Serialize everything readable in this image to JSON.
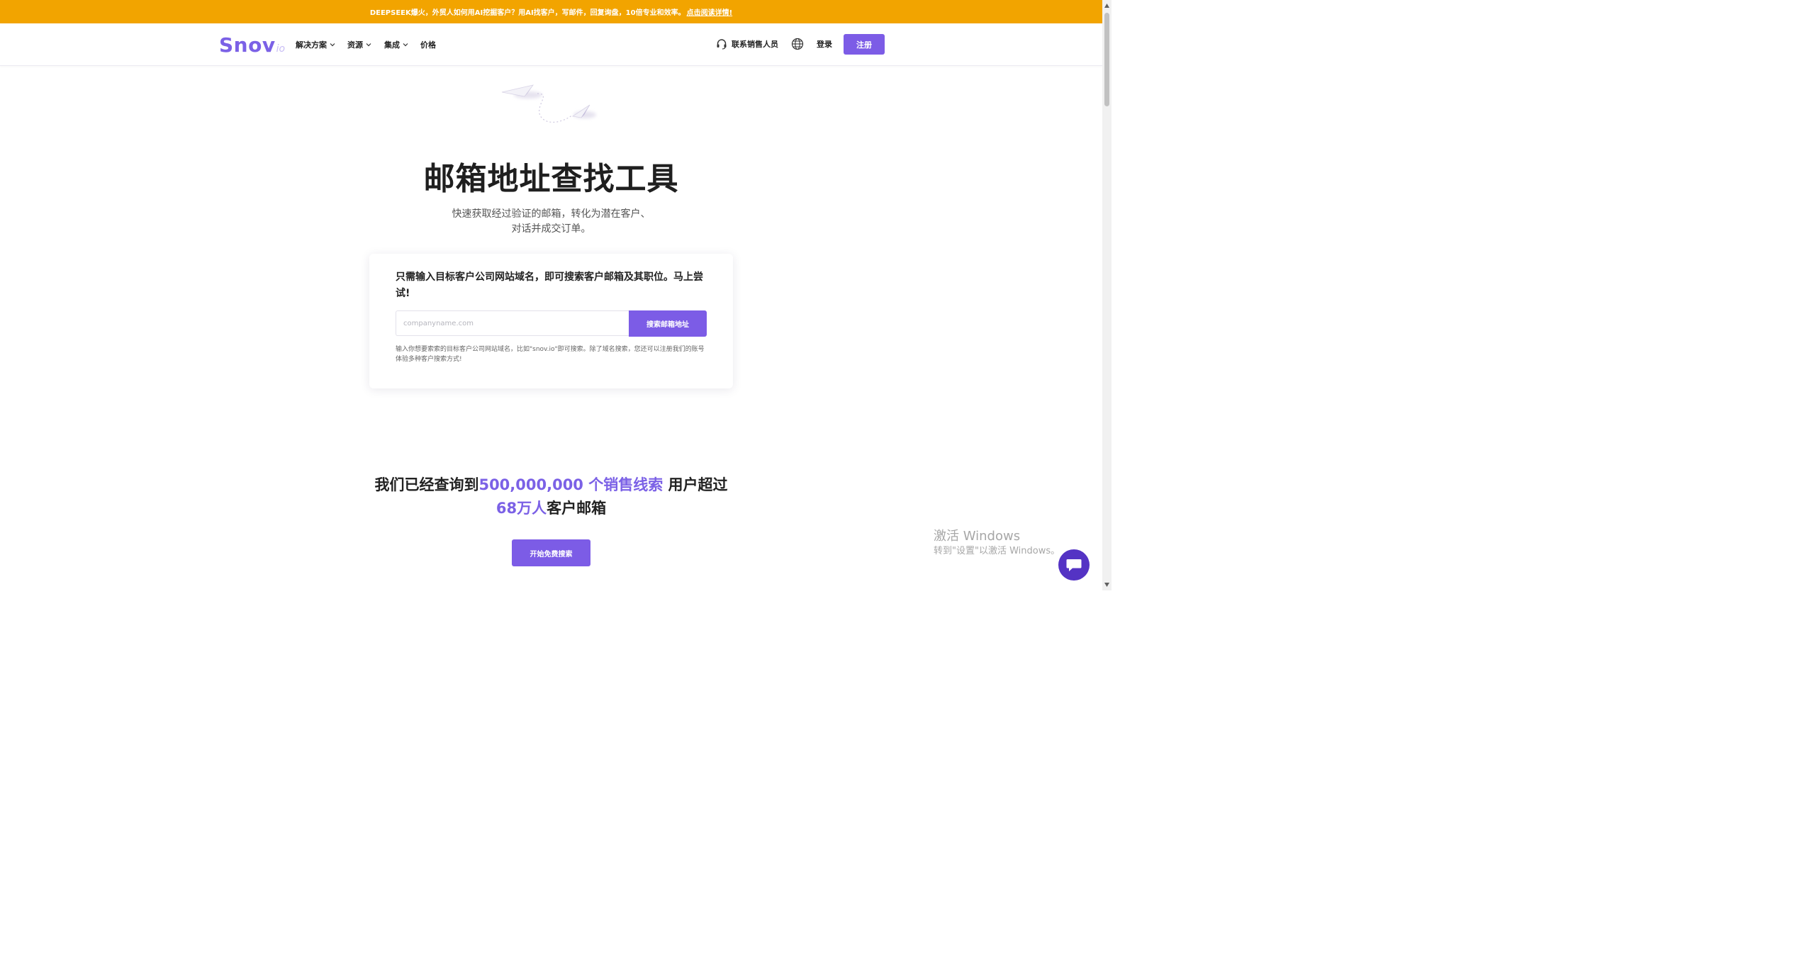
{
  "banner": {
    "text": "DEEPSEEK爆火，外贸人如何用AI挖掘客户？用AI找客户，写邮件，回复询盘，10倍专业和效率。",
    "link": "点击阅读详情!"
  },
  "nav": {
    "logo_main": "Snov",
    "logo_suffix": "io",
    "items": [
      {
        "label": "解决方案"
      },
      {
        "label": "资源"
      },
      {
        "label": "集成"
      },
      {
        "label": "价格"
      }
    ],
    "contact": "联系销售人员",
    "login": "登录",
    "signup": "注册"
  },
  "hero": {
    "title": "邮箱地址查找工具",
    "subtitle_line1": "快速获取经过验证的邮箱，转化为潜在客户、",
    "subtitle_line2": "对话并成交订单。"
  },
  "search_card": {
    "heading": "只需输入目标客户公司网站域名，即可搜索客户邮箱及其职位。马上尝试!",
    "placeholder": "companyname.com",
    "button": "搜索邮箱地址",
    "note": "输入你想要索索的目标客户公司网站域名，比如\"snov.io\"即可搜索。除了域名搜索，您还可以注册我们的账号体验多种客户搜索方式!"
  },
  "stats": {
    "prefix": "我们已经查询到",
    "highlight1": "500,000,000 个销售线索",
    "middle": " 用户超过",
    "highlight2": "68万人",
    "suffix": "客户邮箱"
  },
  "cta": {
    "label": "开始免费搜索"
  },
  "watermark": {
    "line1": "激活 Windows",
    "line2": "转到\"设置\"以激活 Windows。"
  },
  "colors": {
    "banner": "#f2a400",
    "accent": "#7c5ce6",
    "logo": "#7b61e6",
    "chat": "#5433c4"
  }
}
